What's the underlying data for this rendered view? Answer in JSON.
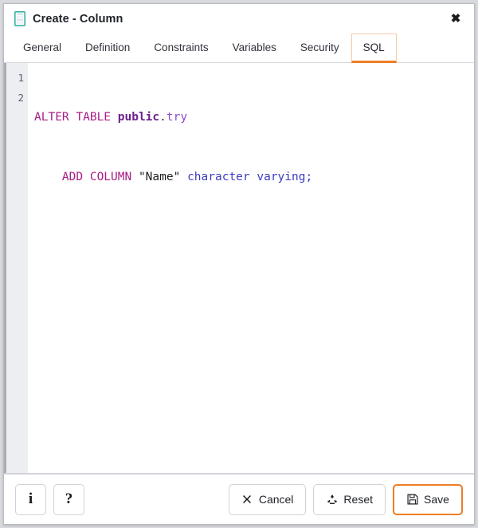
{
  "window": {
    "title": "Create - Column",
    "icon": "column-icon",
    "close_label": "✖"
  },
  "tabs": [
    {
      "label": "General",
      "active": false
    },
    {
      "label": "Definition",
      "active": false
    },
    {
      "label": "Constraints",
      "active": false
    },
    {
      "label": "Variables",
      "active": false
    },
    {
      "label": "Security",
      "active": false
    },
    {
      "label": "SQL",
      "active": true
    }
  ],
  "sql_editor": {
    "line_numbers": [
      "1",
      "2"
    ],
    "lines": [
      {
        "tokens": [
          {
            "text": "ALTER TABLE ",
            "type": "keyword"
          },
          {
            "text": "public",
            "type": "schema"
          },
          {
            "text": ".",
            "type": "punct"
          },
          {
            "text": "try",
            "type": "object"
          }
        ]
      },
      {
        "tokens": [
          {
            "text": "    ",
            "type": "plain"
          },
          {
            "text": "ADD COLUMN ",
            "type": "keyword"
          },
          {
            "text": "\"Name\" ",
            "type": "string"
          },
          {
            "text": "character varying;",
            "type": "type"
          }
        ]
      }
    ],
    "plain_text": "ALTER TABLE public.try\n    ADD COLUMN \"Name\" character varying;"
  },
  "footer": {
    "info_label": "i",
    "help_label": "?",
    "cancel_label": "Cancel",
    "cancel_icon": "cross-icon",
    "reset_label": "Reset",
    "reset_icon": "recycle-icon",
    "save_label": "Save",
    "save_icon": "floppy-disk-icon"
  },
  "colors": {
    "accent": "#ec7c26",
    "accent_light": "#f6c9a4",
    "keyword": "#a71d85",
    "schema": "#6b1f8f",
    "object": "#8c4bc9",
    "datatype": "#3b3bc4",
    "icon_teal": "#38b2a0",
    "gutter_bg": "#eceef2",
    "page_bg": "#d8dade"
  }
}
